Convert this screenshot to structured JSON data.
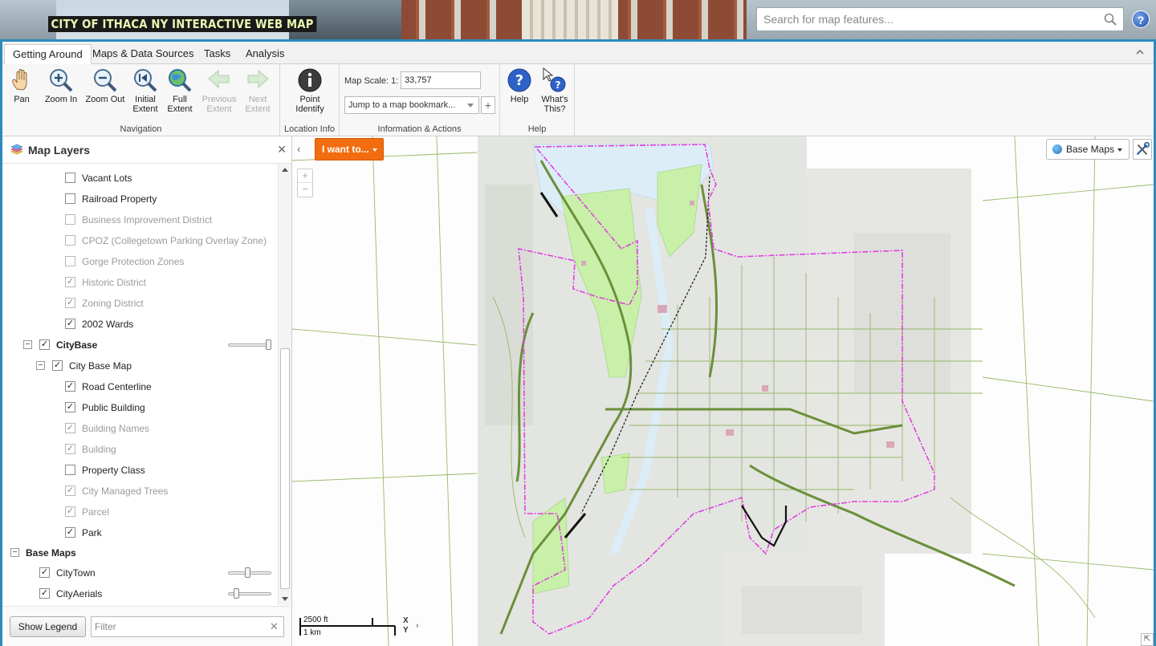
{
  "header": {
    "title": "CITY OF ITHACA NY INTERACTIVE WEB MAP",
    "search_placeholder": "Search for map features..."
  },
  "ribbon": {
    "tabs": [
      "Getting Around",
      "Maps & Data Sources",
      "Tasks",
      "Analysis"
    ],
    "active_tab": "Getting Around",
    "groups": {
      "navigation": {
        "label": "Navigation",
        "tools": [
          {
            "label_line1": "Pan",
            "label_line2": ""
          },
          {
            "label_line1": "Zoom In",
            "label_line2": ""
          },
          {
            "label_line1": "Zoom Out",
            "label_line2": ""
          },
          {
            "label_line1": "Initial",
            "label_line2": "Extent"
          },
          {
            "label_line1": "Full",
            "label_line2": "Extent"
          },
          {
            "label_line1": "Previous",
            "label_line2": "Extent"
          },
          {
            "label_line1": "Next",
            "label_line2": "Extent"
          }
        ]
      },
      "location_info": {
        "label": "Location Info",
        "tools": [
          {
            "label_line1": "Point",
            "label_line2": "Identify"
          }
        ]
      },
      "info_actions": {
        "label": "Information & Actions",
        "map_scale_label": "Map Scale: 1:",
        "map_scale_value": "33,757",
        "bookmark_placeholder": "Jump to a map bookmark...",
        "add_bookmark": "+"
      },
      "help": {
        "label": "Help",
        "tools": [
          {
            "label_line1": "Help",
            "label_line2": ""
          },
          {
            "label_line1": "What's",
            "label_line2": "This?"
          }
        ]
      }
    }
  },
  "layers_panel": {
    "title": "Map Layers",
    "rows": [
      {
        "label": "Vacant Lots",
        "checked": false,
        "dim": false
      },
      {
        "label": "Railroad Property",
        "checked": false,
        "dim": false
      },
      {
        "label": "Business Improvement District",
        "checked": false,
        "dim": true
      },
      {
        "label": "CPOZ (Collegetown Parking Overlay Zone)",
        "checked": false,
        "dim": true
      },
      {
        "label": "Gorge Protection Zones",
        "checked": false,
        "dim": true
      },
      {
        "label": "Historic District",
        "checked": true,
        "dim": true
      },
      {
        "label": "Zoning District",
        "checked": true,
        "dim": true
      },
      {
        "label": "2002 Wards",
        "checked": true,
        "dim": false
      },
      {
        "label": "CityBase",
        "checked": true,
        "dim": false
      },
      {
        "label": "City Base Map",
        "checked": true,
        "dim": false
      },
      {
        "label": "Road Centerline",
        "checked": true,
        "dim": false
      },
      {
        "label": "Public Building",
        "checked": true,
        "dim": false
      },
      {
        "label": "Building Names",
        "checked": true,
        "dim": true
      },
      {
        "label": "Building",
        "checked": true,
        "dim": true
      },
      {
        "label": "Property Class",
        "checked": false,
        "dim": false
      },
      {
        "label": "City Managed Trees",
        "checked": true,
        "dim": true
      },
      {
        "label": "Parcel",
        "checked": true,
        "dim": true
      },
      {
        "label": "Park",
        "checked": true,
        "dim": false
      },
      {
        "label": "Base Maps",
        "checked": null,
        "dim": false
      },
      {
        "label": "CityTown",
        "checked": true,
        "dim": false
      },
      {
        "label": "CityAerials",
        "checked": true,
        "dim": false
      }
    ],
    "opacity": {
      "citybase": 1.0,
      "citytown": 0.45,
      "cityaerials": 0.15
    },
    "show_legend": "Show Legend",
    "filter_placeholder": "Filter"
  },
  "map": {
    "i_want_to": "I want to...",
    "zoom_in": "+",
    "zoom_out": "−",
    "base_maps": "Base Maps",
    "scale_ft": "2500 ft",
    "scale_km": "1 km",
    "coord_x": "X",
    "coord_y": "Y"
  },
  "colors": {
    "accent": "#2c8bbd",
    "i_want_to": "#f26d10",
    "city_boundary": "#e040e0",
    "parks": "#c8f0a8",
    "water": "#dbeef9",
    "roads": "#6b8f3a"
  }
}
